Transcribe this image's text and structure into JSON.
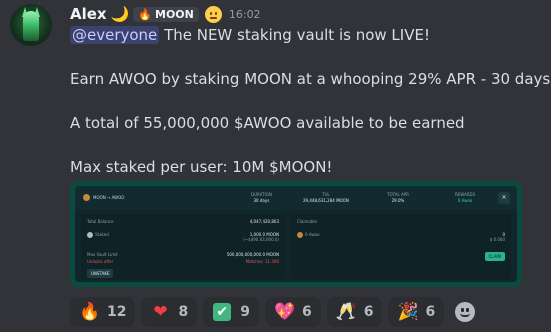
{
  "message": {
    "author": "Alex",
    "author_emoji": "🌙",
    "server_tag_icon": "🔥",
    "server_tag": "MOON",
    "timestamp": "16:02",
    "mention": "@everyone",
    "line1_rest": " The NEW staking vault is now LIVE!",
    "line2": "Earn AWOO by staking MOON at a whooping 29% APR - 30 days!",
    "line3": "A total of 55,000,000 $AWOO available to be earned",
    "line4": "Max staked per user: 10M $MOON!"
  },
  "embed": {
    "token_pair": "MOON → AWOO",
    "duration_label": "DURATION",
    "duration_value": "30 days",
    "tvl_label": "TVL",
    "tvl_value": "29,448,631,284 MOON",
    "apr_label": "TOTAL APR",
    "apr_value": "29.0%",
    "rewards_label": "REWARDS",
    "rewards_value": "0 Awoo",
    "total_balance_label": "Total Balance",
    "total_balance_value": "4,047,420,803",
    "staked_label": "Staked",
    "staked_value": "1,000.0 MOON",
    "staked_sub": "(~$490.03,000.0)",
    "max_vault_label": "Max Vault Limit",
    "max_vault_value": "500,000,000,000.0 MOON",
    "unstake_after_label": "Unlocks after",
    "unstake_after_value": "Matches: 11 300",
    "unstake_button": "UNSTAKE",
    "claimable_label": "Claimable",
    "claimable_token": "0 Awoo",
    "claimable_amount": "0",
    "claimable_sub": "$ 0.000",
    "claim_button": "CLAIM"
  },
  "reactions": [
    {
      "emoji": "🔥",
      "icon": "fire-icon",
      "count": "12"
    },
    {
      "emoji": "❤",
      "icon": "heart-icon",
      "count": "8"
    },
    {
      "emoji": "✔",
      "icon": "check-icon",
      "count": "9"
    },
    {
      "emoji": "💖",
      "icon": "heart-on-fire-icon",
      "count": "6"
    },
    {
      "emoji": "🥂",
      "icon": "cheers-icon",
      "count": "6"
    },
    {
      "emoji": "🎉",
      "icon": "party-popper-icon",
      "count": "6"
    }
  ]
}
